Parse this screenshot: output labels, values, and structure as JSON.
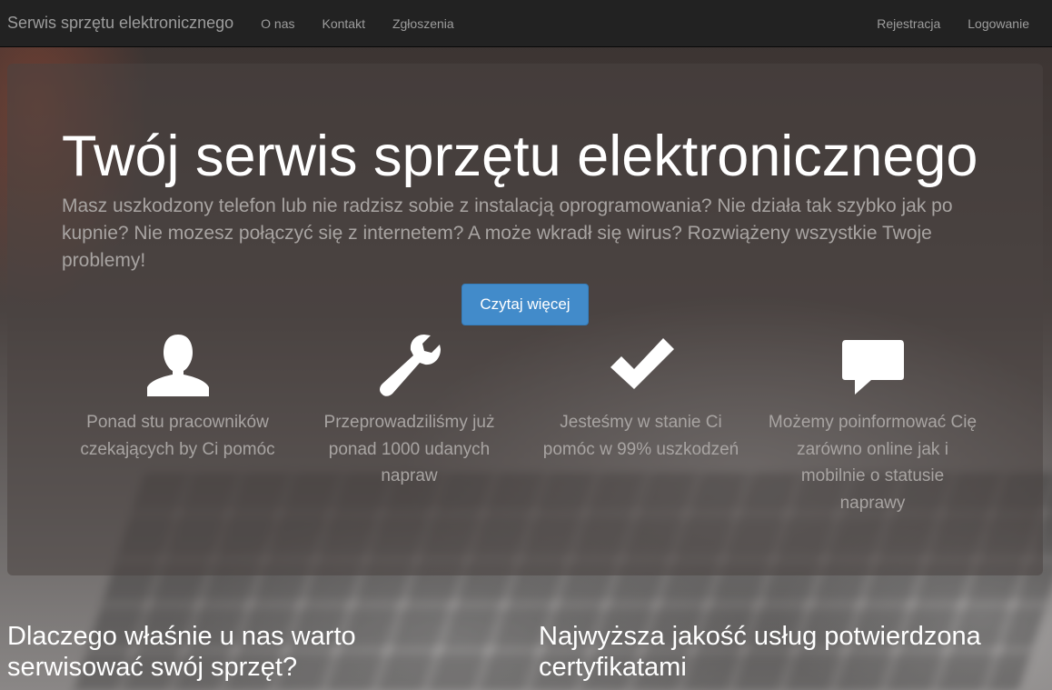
{
  "navbar": {
    "brand": "Serwis sprzętu elektronicznego",
    "left_items": [
      {
        "label": "O nas"
      },
      {
        "label": "Kontakt"
      },
      {
        "label": "Zgłoszenia"
      }
    ],
    "right_items": [
      {
        "label": "Rejestracja"
      },
      {
        "label": "Logowanie"
      }
    ]
  },
  "hero": {
    "title": "Twój serwis sprzętu elektronicznego",
    "text": "Masz uszkodzony telefon lub nie radzisz sobie z instalacją oprogramowania? Nie działa tak szybko jak po kupnie? Nie mozesz połączyć się z internetem? A może wkradł się wirus? Rozwiążeny wszystkie Twoje problemy!",
    "button_label": "Czytaj więcej"
  },
  "features": [
    {
      "icon": "user-icon",
      "text": "Ponad stu pracowników czekających by Ci pomóc"
    },
    {
      "icon": "wrench-icon",
      "text": "Przeprowadziliśmy już ponad 1000 udanych napraw"
    },
    {
      "icon": "checkmark-icon",
      "text": "Jesteśmy w stanie Ci pomóc w 99% uszkodzeń"
    },
    {
      "icon": "comment-icon",
      "text": "Możemy poinformować Cię zarówno online jak i mobilnie o statusie naprawy"
    }
  ],
  "sections": {
    "left_heading": "Dlaczego właśnie u nas warto serwisować swój sprzęt?",
    "right_heading": "Najwyższa jakość usług potwierdzona certyfikatami"
  },
  "colors": {
    "navbar_bg": "#222222",
    "nav_text": "#9d9d9d",
    "primary_button": "#428bca",
    "muted_text": "#a8a4a2"
  }
}
